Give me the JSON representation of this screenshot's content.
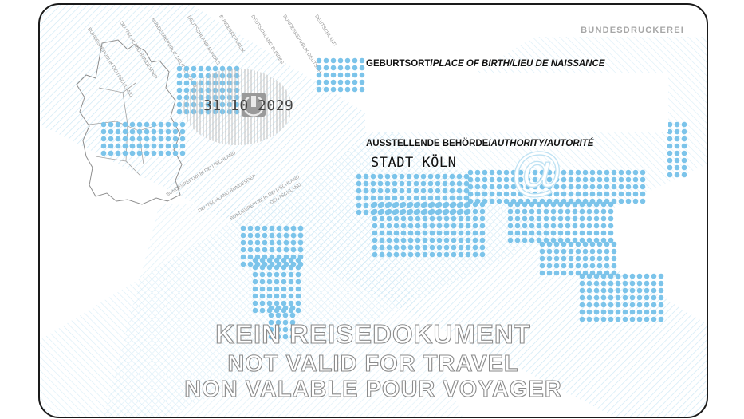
{
  "card": {
    "issuer": "BUNDESDRUCKEREI",
    "expiry_date": "31 10 2029",
    "place_of_birth": {
      "label_de": "GEBURTSORT/",
      "label_en_fr": "PLACE OF BIRTH/LIEU DE NAISSANCE",
      "value": ""
    },
    "authority": {
      "label_de": "AUSSTELLENDE BEHÖRDE/",
      "label_en_fr": "AUTHORITY/AUTORITÉ",
      "value": "STADT KÖLN"
    },
    "watermark_text": [
      "BUNDESREPUBLIK DEUTSCHLAND",
      "DEUTSCHLAND BUNDESREP",
      "BUNDESREPUBLIK"
    ],
    "warning_lines": [
      "KEIN REISEDOKUMENT",
      "NOT VALID FOR TRAVEL",
      "NON VALABLE POUR VOYAGER"
    ]
  },
  "colors": {
    "dot_blue": "#7cc4ea",
    "hatch_blue": "#c6e4f3",
    "outline_gray": "#8a8a8a"
  }
}
